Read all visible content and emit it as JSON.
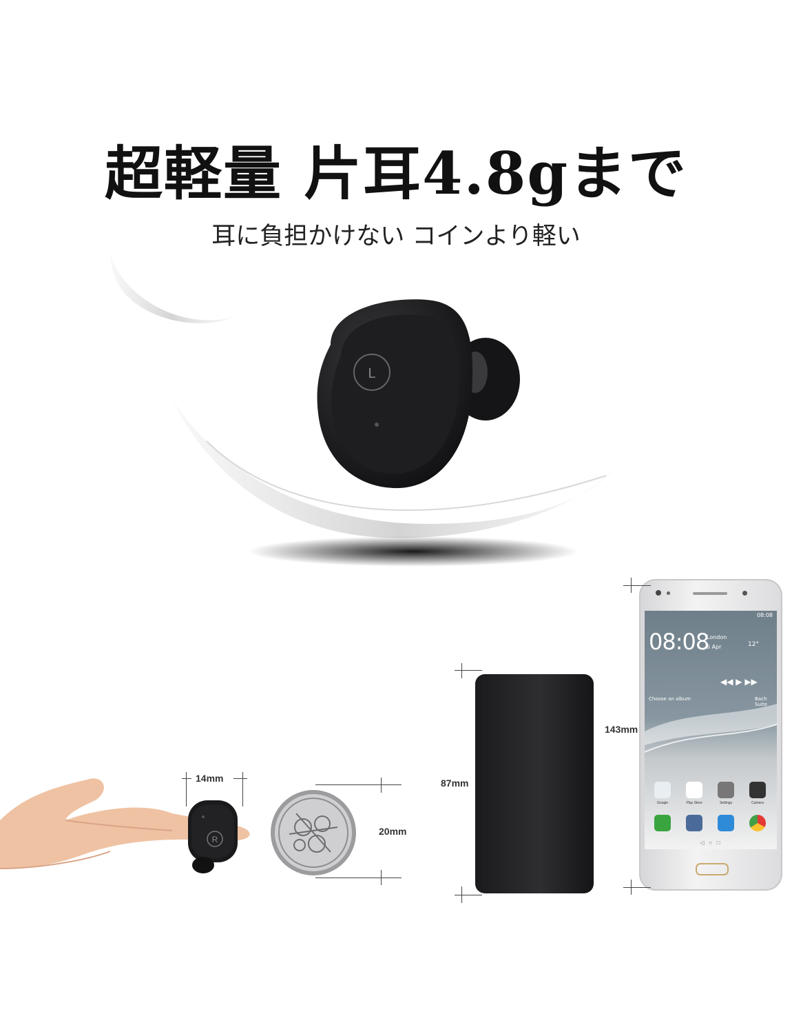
{
  "headline": "超軽量 片耳4.8gまで",
  "subheadline": "耳に負担かけない コインより軽い",
  "earbud_hero": {
    "button_mark": "L"
  },
  "earbud_small": {
    "button_mark": "R"
  },
  "dimensions": {
    "earbud_width": "14mm",
    "coin_diameter": "20mm",
    "case_height": "87mm",
    "phone_height": "143mm"
  },
  "phone": {
    "status_time": "08:08",
    "clock": "08:08",
    "city": "London",
    "date": "6 Apr",
    "temperature": "12°",
    "album_prompt": "Choose an album",
    "track": "Bach Suite",
    "apps_row1": [
      "Google",
      "Play Store",
      "Settings",
      "Camera"
    ]
  },
  "colors": {
    "device_black": "#1b1b1d",
    "phone_screen_top": "#7a8891",
    "phone_body": "#e6e6e8"
  }
}
